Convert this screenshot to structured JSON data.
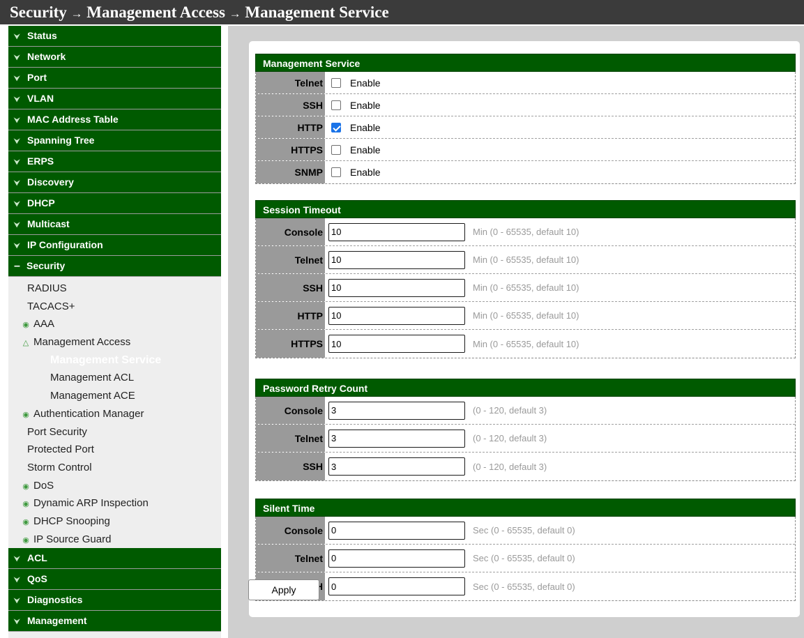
{
  "breadcrumb": {
    "part1": "Security",
    "arrow": "→",
    "part2": "Management Access",
    "part3": "Management Service"
  },
  "sidebar": {
    "top_items": [
      "Status",
      "Network",
      "Port",
      "VLAN",
      "MAC Address Table",
      "Spanning Tree",
      "ERPS",
      "Discovery",
      "DHCP",
      "Multicast",
      "IP Configuration"
    ],
    "open_item": "Security",
    "security_children": {
      "radius": "RADIUS",
      "tacacs": "TACACS+",
      "aaa": "AAA",
      "mgmt_access": "Management Access",
      "mgmt_service": "Management Service",
      "mgmt_acl": "Management ACL",
      "mgmt_ace": "Management ACE",
      "auth_manager": "Authentication Manager",
      "port_security": "Port Security",
      "protected_port": "Protected Port",
      "storm_control": "Storm Control",
      "dos": "DoS",
      "dai": "Dynamic ARP Inspection",
      "dhcp_snooping": "DHCP Snooping",
      "ip_source_guard": "IP Source Guard"
    },
    "bottom_items": [
      "ACL",
      "QoS",
      "Diagnostics",
      "Management"
    ]
  },
  "management_service": {
    "title": "Management Service",
    "enable_label": "Enable",
    "rows": [
      {
        "label": "Telnet",
        "checked": false
      },
      {
        "label": "SSH",
        "checked": false
      },
      {
        "label": "HTTP",
        "checked": true
      },
      {
        "label": "HTTPS",
        "checked": false
      },
      {
        "label": "SNMP",
        "checked": false
      }
    ]
  },
  "session_timeout": {
    "title": "Session Timeout",
    "hint": "Min (0 - 65535, default 10)",
    "rows": [
      {
        "label": "Console",
        "value": "10"
      },
      {
        "label": "Telnet",
        "value": "10"
      },
      {
        "label": "SSH",
        "value": "10"
      },
      {
        "label": "HTTP",
        "value": "10"
      },
      {
        "label": "HTTPS",
        "value": "10"
      }
    ]
  },
  "password_retry": {
    "title": "Password Retry Count",
    "hint": "(0 - 120, default 3)",
    "rows": [
      {
        "label": "Console",
        "value": "3"
      },
      {
        "label": "Telnet",
        "value": "3"
      },
      {
        "label": "SSH",
        "value": "3"
      }
    ]
  },
  "silent_time": {
    "title": "Silent Time",
    "hint": "Sec (0 - 65535, default 0)",
    "rows": [
      {
        "label": "Console",
        "value": "0"
      },
      {
        "label": "Telnet",
        "value": "0"
      },
      {
        "label": "SSH",
        "value": "0"
      }
    ]
  },
  "apply_label": "Apply",
  "colors": {
    "nav_green": "#005a00",
    "title_bar": "#3b3b3b",
    "label_gray": "#9a9a9a",
    "checkbox_checked": "#1a73e8"
  }
}
